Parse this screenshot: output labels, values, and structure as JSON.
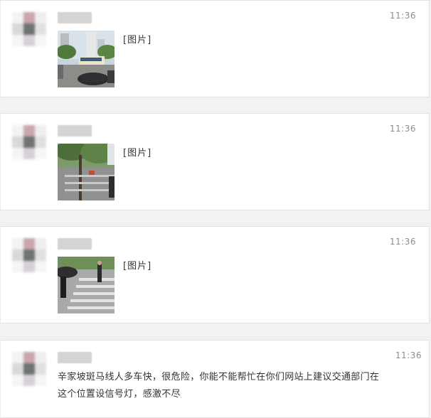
{
  "messages": [
    {
      "time": "11:36",
      "image_tag": "[图片]",
      "image": "photo-street-bus"
    },
    {
      "time": "11:36",
      "image_tag": "[图片]",
      "image": "photo-street-tree"
    },
    {
      "time": "11:36",
      "image_tag": "[图片]",
      "image": "photo-crosswalk"
    },
    {
      "time": "11:36",
      "text_lines": [
        "辛家坡斑马线人多车快，很危险，你能不能帮忙在你们网站上建议交通部门在",
        "这个位置设信号灯，感激不尽"
      ]
    }
  ],
  "colors": {
    "background": "#f2f2f2",
    "card": "#ffffff",
    "time_text": "#8c8c8c",
    "body_text": "#333333"
  }
}
